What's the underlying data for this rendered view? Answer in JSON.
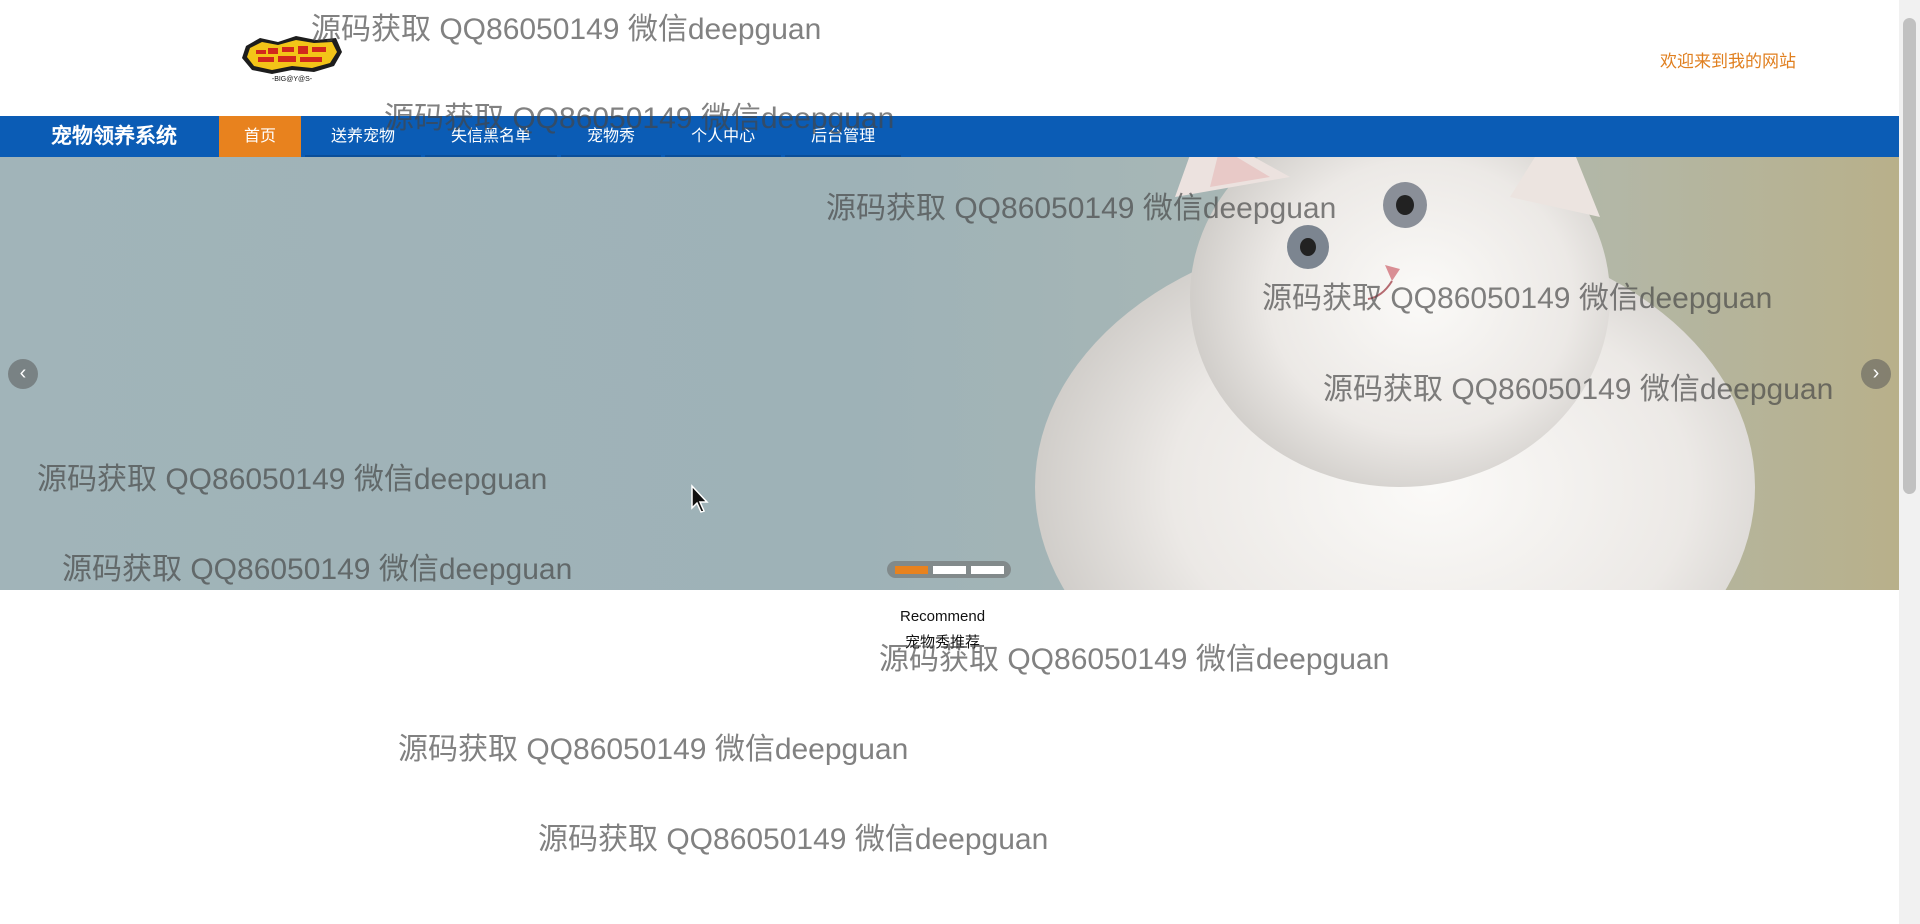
{
  "header": {
    "welcome_text": "欢迎来到我的网站",
    "logo_icon": "digimon-adventure-logo"
  },
  "nav": {
    "brand": "宠物领养系统",
    "items": [
      {
        "label": "首页",
        "active": true
      },
      {
        "label": "送养宠物",
        "active": false
      },
      {
        "label": "失信黑名单",
        "active": false
      },
      {
        "label": "宠物秀",
        "active": false
      },
      {
        "label": "个人中心",
        "active": false
      },
      {
        "label": "后台管理",
        "active": false
      }
    ],
    "bar_color": "#0b5cb5",
    "active_color": "#e8821e"
  },
  "banner": {
    "image": "white-cat-photo",
    "prev_icon": "chevron-left-icon",
    "next_icon": "chevron-right-icon",
    "prev_glyph": "‹",
    "next_glyph": "›",
    "slide_count": 3,
    "active_slide": 1
  },
  "section": {
    "title_en": "Recommend",
    "title_cn": "宠物秀推荐"
  },
  "watermark": {
    "text": "源码获取 QQ86050149 微信deepguan"
  }
}
